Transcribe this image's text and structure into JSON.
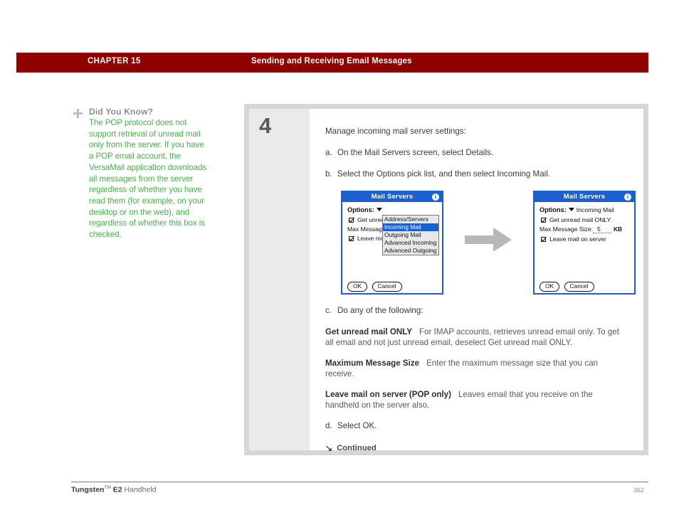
{
  "header": {
    "chapter": "CHAPTER 15",
    "title": "Sending and Receiving Email Messages",
    "band_color": "#8f0000"
  },
  "sidebar": {
    "icon": "plus-icon",
    "heading": "Did You Know?",
    "body": "The POP protocol does not support retrieval of unread mail only from the server. If you have a POP email account, the VersaMail application downloads all messages from the server regardless of whether you have read them (for example, on your desktop or on the web), and regardless of whether this box is checked.",
    "text_color": "#4ab14a"
  },
  "step": {
    "number": "4",
    "lead": "Manage incoming mail server settings:",
    "sub_steps": [
      {
        "letter": "a.",
        "text": "On the Mail Servers screen, select Details."
      },
      {
        "letter": "b.",
        "text": "Select the Options pick list, and then select Incoming Mail."
      },
      {
        "letter": "c.",
        "text": "Do any of the following:"
      },
      {
        "letter": "d.",
        "text": "Select OK."
      }
    ],
    "definitions": [
      {
        "term": "Get unread mail ONLY",
        "desc": "For IMAP accounts, retrieves unread email only. To get all email and not just unread email, deselect Get unread mail ONLY."
      },
      {
        "term": "Maximum Message Size",
        "desc": "Enter the maximum message size that you can receive."
      },
      {
        "term": "Leave mail on server (POP only)",
        "desc": "Leaves email that you receive on the handheld on the server also."
      }
    ],
    "continued": "Continued",
    "continued_arrow": "↘"
  },
  "pda_left": {
    "title": "Mail Servers",
    "info_icon": "i",
    "options_label": "Options:",
    "caret": "chevron-down-icon",
    "checkbox_unread": "Get unrec",
    "label_maxsize": "Max Message",
    "checkbox_leave": "Leave mc",
    "picklist": [
      {
        "label": "Address/Servers",
        "selected": false
      },
      {
        "label": "Incoming Mail",
        "selected": true
      },
      {
        "label": "Outgoing Mail",
        "selected": false
      },
      {
        "label": "Advanced Incoming",
        "selected": false
      },
      {
        "label": "Advanced Outgoing",
        "selected": false
      }
    ],
    "ok": "OK",
    "cancel": "Cancel"
  },
  "pda_right": {
    "title": "Mail Servers",
    "info_icon": "i",
    "options_label": "Options:",
    "options_value": "Incoming Mail",
    "checkbox_unread": "Get unread mail ONLY",
    "label_maxsize": "Max Message Size:",
    "maxsize_value": "5",
    "maxsize_unit": "KB",
    "checkbox_leave": "Leave mail on server",
    "ok": "OK",
    "cancel": "Cancel"
  },
  "footer": {
    "product_bold": "Tungsten",
    "trademark": "TM",
    "product_model": "E2",
    "product_rest": "Handheld",
    "page_number": "362"
  }
}
